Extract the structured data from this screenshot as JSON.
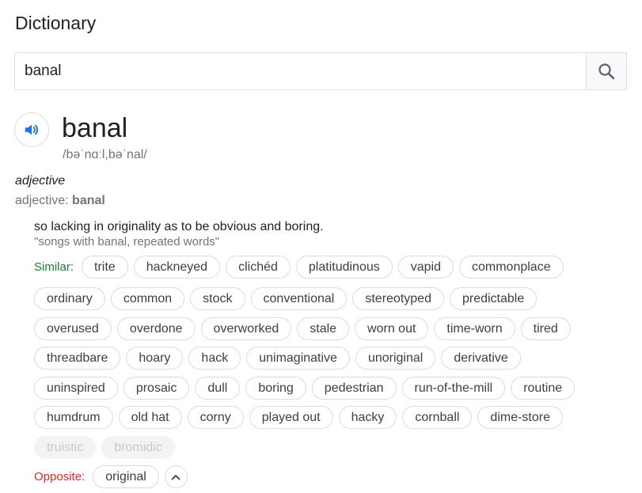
{
  "title": "Dictionary",
  "search": {
    "value": "banal"
  },
  "entry": {
    "word": "banal",
    "phonetic": "/bəˈnɑːl,bəˈnal/",
    "pos_italic": "adjective",
    "pos_prefix": "adjective: ",
    "pos_word": "banal",
    "definition": "so lacking in originality as to be obvious and boring.",
    "example": "\"songs with banal, repeated words\""
  },
  "similar_label": "Similar:",
  "similar_rows": [
    [
      "trite",
      "hackneyed",
      "clichéd",
      "platitudinous",
      "vapid",
      "commonplace"
    ],
    [
      "ordinary",
      "common",
      "stock",
      "conventional",
      "stereotyped",
      "predictable"
    ],
    [
      "overused",
      "overdone",
      "overworked",
      "stale",
      "worn out",
      "time-worn",
      "tired"
    ],
    [
      "threadbare",
      "hoary",
      "hack",
      "unimaginative",
      "unoriginal",
      "derivative"
    ],
    [
      "uninspired",
      "prosaic",
      "dull",
      "boring",
      "pedestrian",
      "run-of-the-mill",
      "routine"
    ],
    [
      "humdrum",
      "old hat",
      "corny",
      "played out",
      "hacky",
      "cornball",
      "dime-store"
    ]
  ],
  "faded": [
    "truistic",
    "bromidic"
  ],
  "opposite_label": "Opposite:",
  "opposite": [
    "original"
  ],
  "colors": {
    "similar_label": "#188038",
    "opposite_label": "#d93025",
    "speaker": "#1a73e8"
  }
}
